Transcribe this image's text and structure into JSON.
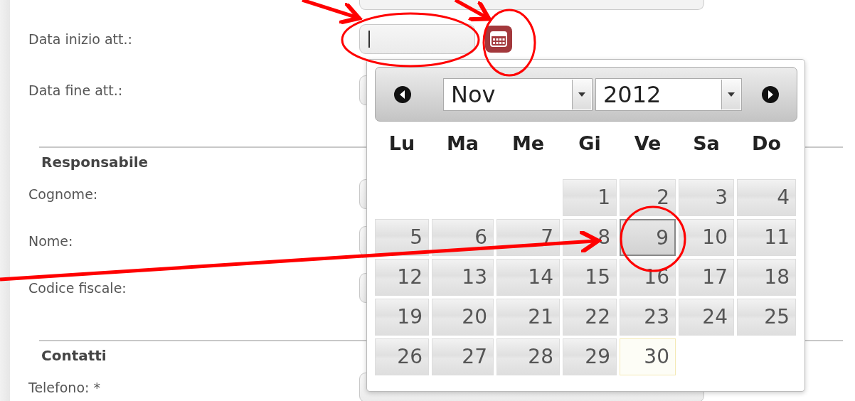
{
  "form": {
    "rows": [
      {
        "kind": "date",
        "label": "Data inizio att.:",
        "focused": true
      },
      {
        "kind": "date",
        "label": "Data fine att.:"
      },
      {
        "kind": "section",
        "title": "Responsabile"
      },
      {
        "kind": "text",
        "label": "Cognome:"
      },
      {
        "kind": "text",
        "label": "Nome:"
      },
      {
        "kind": "text",
        "label": "Codice fiscale:"
      },
      {
        "kind": "section",
        "title": "Contatti"
      },
      {
        "kind": "text",
        "label": "Telefono: *"
      }
    ]
  },
  "datepicker": {
    "month": "Nov",
    "year": "2012",
    "weekdays": [
      "Lu",
      "Ma",
      "Me",
      "Gi",
      "Ve",
      "Sa",
      "Do"
    ],
    "weeks": [
      [
        {
          "kind": "blank"
        },
        {
          "kind": "blank"
        },
        {
          "kind": "blank"
        },
        {
          "day": "1",
          "selected": false,
          "today": false
        },
        {
          "day": "2",
          "selected": false,
          "today": false
        },
        {
          "day": "3",
          "selected": false,
          "today": false
        },
        {
          "day": "4",
          "selected": false,
          "today": false
        }
      ],
      [
        {
          "day": "5",
          "selected": false,
          "today": false
        },
        {
          "day": "6",
          "selected": false,
          "today": false
        },
        {
          "day": "7",
          "selected": false,
          "today": false
        },
        {
          "day": "8",
          "selected": false,
          "today": false
        },
        {
          "day": "9",
          "selected": true,
          "today": false
        },
        {
          "day": "10",
          "selected": false,
          "today": false
        },
        {
          "day": "11",
          "selected": false,
          "today": false
        }
      ],
      [
        {
          "day": "12",
          "selected": false,
          "today": false
        },
        {
          "day": "13",
          "selected": false,
          "today": false
        },
        {
          "day": "14",
          "selected": false,
          "today": false
        },
        {
          "day": "15",
          "selected": false,
          "today": false
        },
        {
          "day": "16",
          "selected": false,
          "today": false
        },
        {
          "day": "17",
          "selected": false,
          "today": false
        },
        {
          "day": "18",
          "selected": false,
          "today": false
        }
      ],
      [
        {
          "day": "19",
          "selected": false,
          "today": false
        },
        {
          "day": "20",
          "selected": false,
          "today": false
        },
        {
          "day": "21",
          "selected": false,
          "today": false
        },
        {
          "day": "22",
          "selected": false,
          "today": false
        },
        {
          "day": "23",
          "selected": false,
          "today": false
        },
        {
          "day": "24",
          "selected": false,
          "today": false
        },
        {
          "day": "25",
          "selected": false,
          "today": false
        }
      ],
      [
        {
          "day": "26",
          "selected": false,
          "today": false
        },
        {
          "day": "27",
          "selected": false,
          "today": false
        },
        {
          "day": "28",
          "selected": false,
          "today": false
        },
        {
          "day": "29",
          "selected": false,
          "today": false
        },
        {
          "day": "30",
          "selected": false,
          "today": true
        },
        {
          "kind": "blank"
        },
        {
          "kind": "blank"
        }
      ]
    ]
  }
}
